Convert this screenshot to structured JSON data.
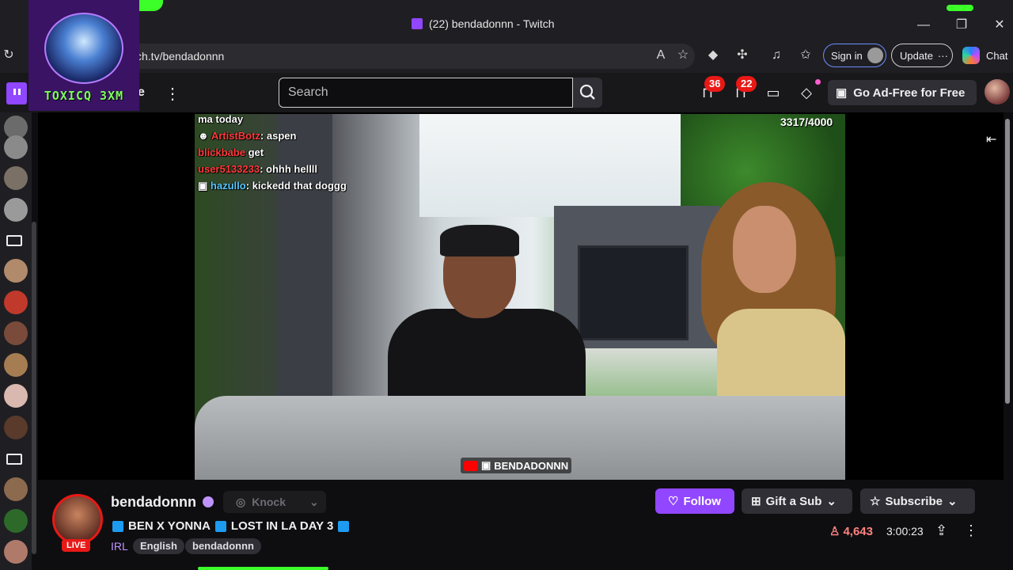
{
  "browser": {
    "tab_title": "(22) bendadonnn - Twitch",
    "url": "ch.tv/bendadonnn",
    "sign_in_label": "Sign in",
    "update_label": "Update",
    "chat_label": "Chat",
    "window_controls": [
      "minimize",
      "restore",
      "close"
    ]
  },
  "overlay_logo": {
    "text": "TOXICQ 3XM"
  },
  "nav": {
    "search_placeholder": "Search",
    "notifications_count": "36",
    "inbox_count": "22",
    "ad_free_label": "Go Ad-Free for Free",
    "partial_browse": "e"
  },
  "player": {
    "viewer_goal": "3317/4000",
    "watermark": "BENDADONNN",
    "chat_messages": [
      {
        "user": "",
        "text": "ma today"
      },
      {
        "user": "",
        "text": "aspen"
      },
      {
        "user": "",
        "text": "get"
      },
      {
        "user": "",
        "text": "ohhh hellll"
      },
      {
        "user": "hazullo",
        "text": "kickedd that doggg"
      }
    ]
  },
  "channel": {
    "name": "bendadonnn",
    "live_label": "LIVE",
    "knock_label": "Knock",
    "title": "BEN X YONNA",
    "title_part2": "LOST IN LA DAY 3",
    "category": "IRL",
    "tags": [
      "English",
      "bendadonnn"
    ],
    "follow_label": "Follow",
    "gift_label": "Gift a Sub",
    "subscribe_label": "Subscribe",
    "viewer_count": "4,643",
    "uptime": "3:00:23"
  },
  "colors": {
    "twitch_purple": "#9146ff",
    "live_red": "#e91916",
    "accent_green": "#3cff2a"
  }
}
